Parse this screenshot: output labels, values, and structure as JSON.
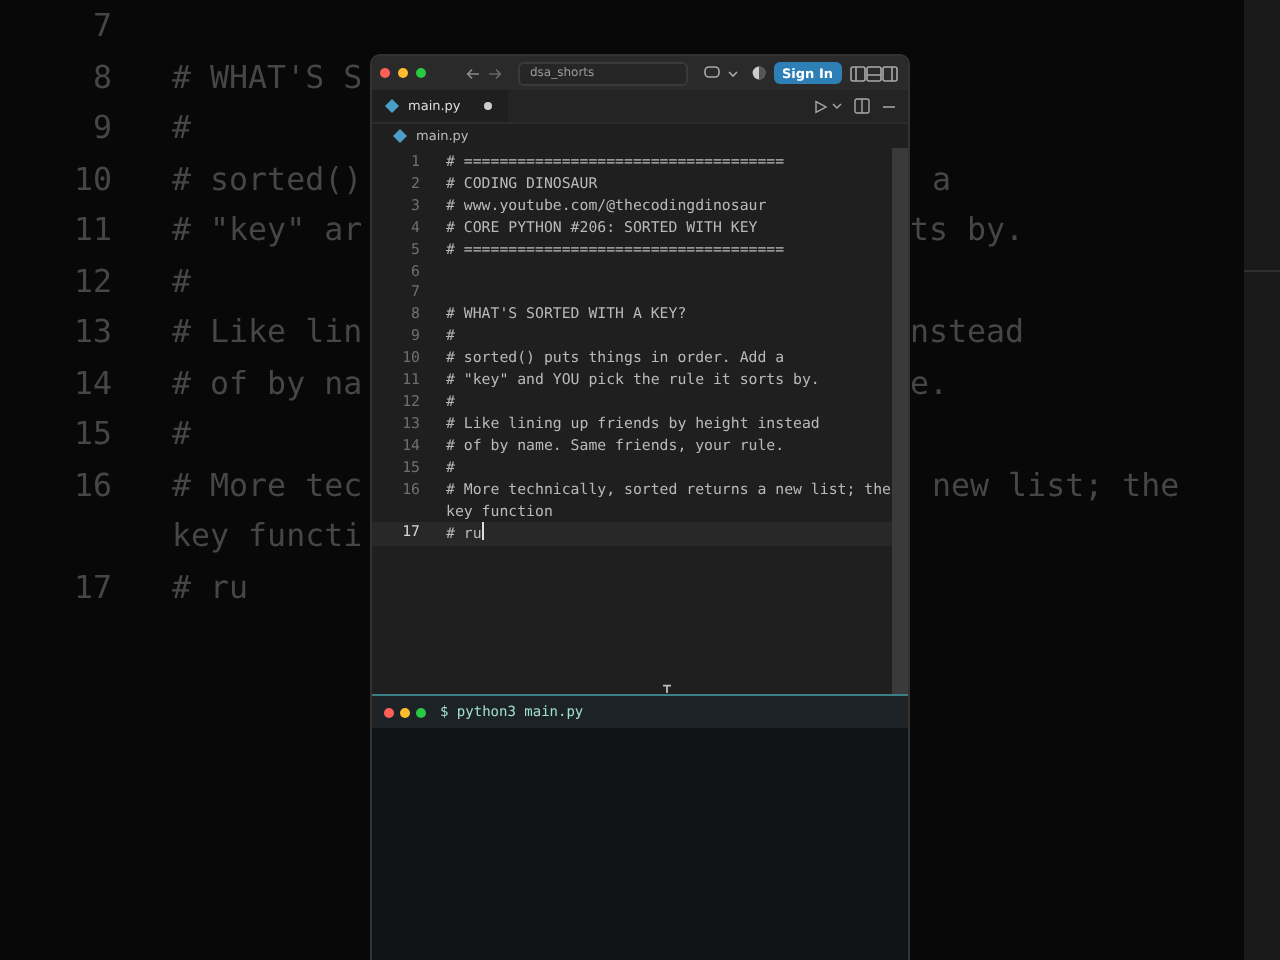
{
  "background": [
    {
      "number": "7"
    },
    {
      "number": "8",
      "code": "# WHAT'S S"
    },
    {
      "number": "9",
      "code": "#"
    },
    {
      "number": "10",
      "code": "# sorted()",
      "right_code": "a",
      "right_indent": true
    },
    {
      "number": "11",
      "code": "# \"key\" ar",
      "right_code": "ts by.",
      "right_indent": false
    },
    {
      "number": "12",
      "code": "#"
    },
    {
      "number": "13",
      "code": "# Like lin",
      "right_code": "nstead",
      "right_indent": false
    },
    {
      "number": "14",
      "code": "# of by na",
      "right_code": "e.",
      "right_indent": false
    },
    {
      "number": "15",
      "code": "#"
    },
    {
      "number": "16",
      "code": "# More tec",
      "right_code": "new list; the",
      "right_indent": true
    },
    {
      "code": "key functi"
    },
    {
      "number": "17",
      "code": "# ru"
    }
  ],
  "window": {
    "search": "dsa_shorts",
    "sign_in": "Sign In",
    "tab": {
      "label": "main.py",
      "modified": true
    },
    "breadcrumb": "main.py",
    "lines": [
      {
        "number": "1",
        "text": "# ====================================",
        "current": false
      },
      {
        "number": "2",
        "text": "# CODING DINOSAUR",
        "current": false
      },
      {
        "number": "3",
        "text": "# www.youtube.com/@thecodingdinosaur",
        "current": false
      },
      {
        "number": "4",
        "text": "# CORE PYTHON #206: SORTED WITH KEY",
        "current": false
      },
      {
        "number": "5",
        "text": "# ====================================",
        "current": false
      },
      {
        "number": "6",
        "current": false
      },
      {
        "number": "7",
        "current": false
      },
      {
        "number": "8",
        "text": "# WHAT'S SORTED WITH A KEY?",
        "current": false
      },
      {
        "number": "9",
        "text": "#",
        "current": false
      },
      {
        "number": "10",
        "text": "# sorted() puts things in order. Add a",
        "current": false
      },
      {
        "number": "11",
        "text": "# \"key\" and YOU pick the rule it sorts by.",
        "current": false
      },
      {
        "number": "12",
        "text": "#",
        "current": false
      },
      {
        "number": "13",
        "text": "# Like lining up friends by height instead",
        "current": false
      },
      {
        "number": "14",
        "text": "# of by name. Same friends, your rule.",
        "current": false
      },
      {
        "number": "15",
        "text": "#",
        "current": false
      },
      {
        "number": "16",
        "text": "# More technically, sorted returns a new list; the key function",
        "current": false
      },
      {
        "number": "17",
        "text": "# ru",
        "current": true
      }
    ],
    "terminal": {
      "command": "$ python3 main.py"
    }
  }
}
